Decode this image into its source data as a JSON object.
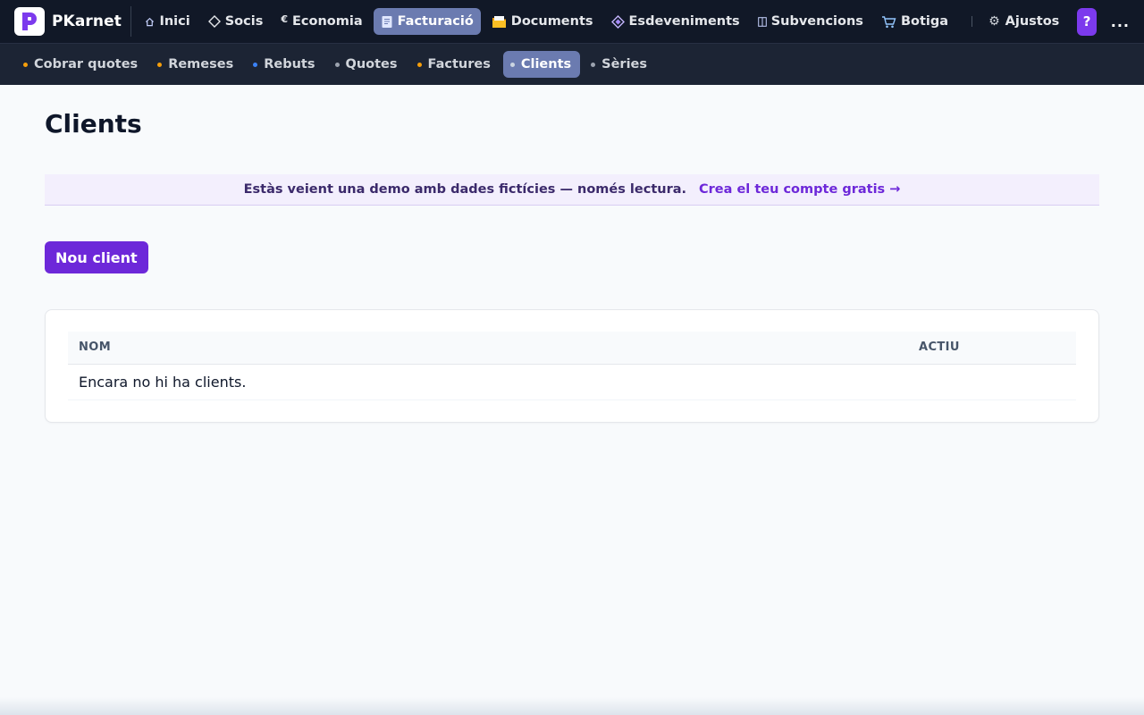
{
  "brand": {
    "name": "PKarnet",
    "logo_letter": "P",
    "color": "#7c3aed"
  },
  "nav": {
    "items": [
      {
        "id": "inici",
        "label": "Inici",
        "icon": "home-icon"
      },
      {
        "id": "socis",
        "label": "Socis",
        "icon": "diamond-icon"
      },
      {
        "id": "economia",
        "label": "Economia",
        "icon": "euro-icon"
      },
      {
        "id": "facturacio",
        "label": "Facturació",
        "icon": "receipt-icon",
        "active": true
      },
      {
        "id": "documents",
        "label": "Documents",
        "icon": "folder-icon"
      },
      {
        "id": "esdeveniments",
        "label": "Esdeveniments",
        "icon": "gem-icon"
      },
      {
        "id": "subvencions",
        "label": "Subvencions",
        "icon": "columns-icon"
      },
      {
        "id": "botiga",
        "label": "Botiga",
        "icon": "cart-icon"
      }
    ],
    "settings_label": "Ajustos",
    "settings_icon": "gear-icon",
    "help_label": "?",
    "more_label": "..."
  },
  "subnav": {
    "items": [
      {
        "id": "cobrar-quotes",
        "label": "Cobrar quotes",
        "dot": "#f59e0b"
      },
      {
        "id": "remeses",
        "label": "Remeses",
        "dot": "#f59e0b"
      },
      {
        "id": "rebuts",
        "label": "Rebuts",
        "dot": "#3b82f6"
      },
      {
        "id": "quotes",
        "label": "Quotes",
        "dot": "#9ca3af"
      },
      {
        "id": "factures",
        "label": "Factures",
        "dot": "#f59e0b"
      },
      {
        "id": "clients",
        "label": "Clients",
        "dot": "#cbd5e1",
        "active": true
      },
      {
        "id": "series",
        "label": "Sèries",
        "dot": "#9ca3af"
      }
    ]
  },
  "page": {
    "title": "Clients",
    "demo_message": "Estàs veient una demo amb dades fictícies — només lectura.",
    "demo_link": "Crea el teu compte gratis →",
    "new_button": "Nou client"
  },
  "table": {
    "columns": [
      "NOM",
      "ACTIU"
    ],
    "empty_message": "Encara no hi ha clients."
  }
}
